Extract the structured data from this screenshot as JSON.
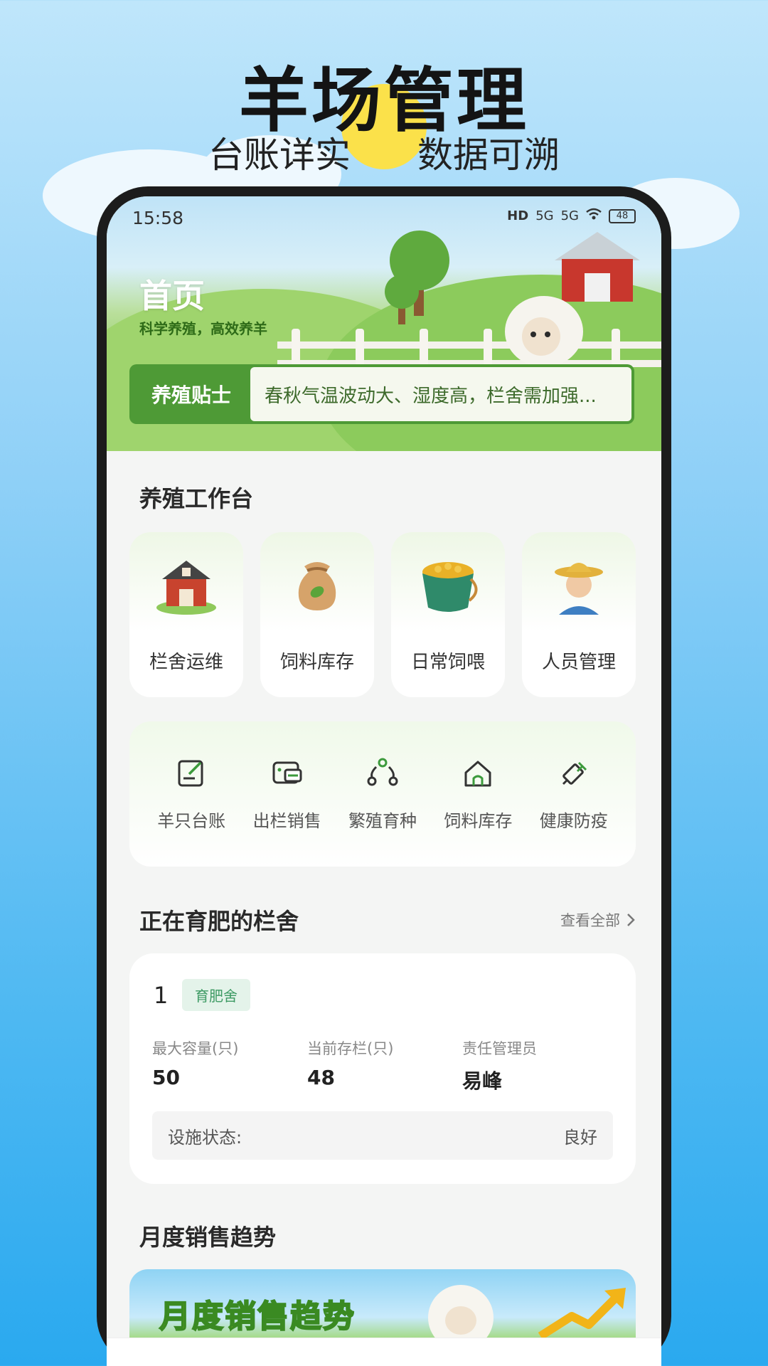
{
  "promo": {
    "title": "羊场管理",
    "subtitle_left": "台账详实",
    "subtitle_right": "数据可溯"
  },
  "status_bar": {
    "time": "15:58",
    "hd_label": "HD",
    "signal_1": "5G",
    "signal_2": "5G",
    "battery": "48"
  },
  "hero": {
    "title": "首页",
    "subtitle": "科学养殖，高效养羊",
    "tips_label": "养殖贴士",
    "tips_text": "春秋气温波动大、湿度高，栏舍需加强..."
  },
  "workbench": {
    "title": "养殖工作台",
    "items": [
      {
        "label": "栏舍运维",
        "icon": "barn-icon"
      },
      {
        "label": "饲料库存",
        "icon": "feed-sack-icon"
      },
      {
        "label": "日常饲喂",
        "icon": "feed-bucket-icon"
      },
      {
        "label": "人员管理",
        "icon": "farmer-icon"
      }
    ]
  },
  "quick_actions": [
    {
      "label": "羊只台账",
      "icon": "ledger-edit-icon"
    },
    {
      "label": "出栏销售",
      "icon": "sales-wallet-icon"
    },
    {
      "label": "繁殖育种",
      "icon": "breeding-cycle-icon"
    },
    {
      "label": "饲料库存",
      "icon": "house-icon"
    },
    {
      "label": "健康防疫",
      "icon": "syringe-icon"
    }
  ],
  "fattening": {
    "title": "正在育肥的栏舍",
    "view_all": "查看全部",
    "pen": {
      "number": "1",
      "tag": "育肥舍",
      "stats": [
        {
          "label": "最大容量(只)",
          "value": "50"
        },
        {
          "label": "当前存栏(只)",
          "value": "48"
        },
        {
          "label": "责任管理员",
          "value": "易峰"
        }
      ],
      "facility_label": "设施状态:",
      "facility_value": "良好"
    }
  },
  "sales": {
    "title": "月度销售趋势",
    "banner_text": "月度销售趋势"
  },
  "colors": {
    "primary_green": "#4e9a36",
    "tag_green": "#3c9a63",
    "sky_blue": "#4db8f2"
  }
}
